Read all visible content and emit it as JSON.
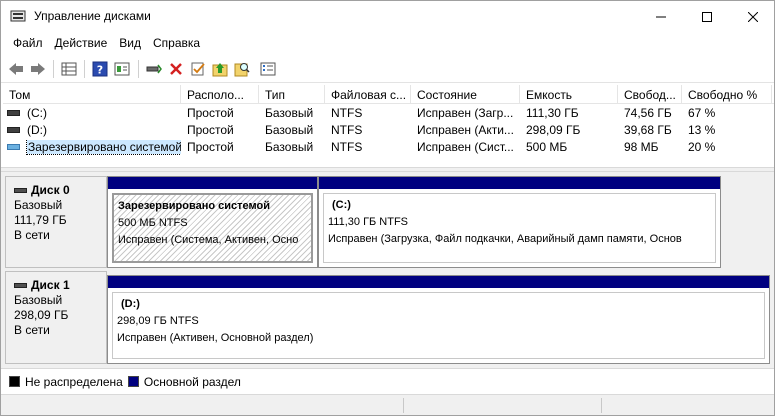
{
  "window": {
    "title": "Управление дисками"
  },
  "menu": [
    "Файл",
    "Действие",
    "Вид",
    "Справка"
  ],
  "table": {
    "columns": [
      "Том",
      "Располо...",
      "Тип",
      "Файловая с...",
      "Состояние",
      "Емкость",
      "Свобод...",
      "Свободно %"
    ],
    "rows": [
      {
        "name": "(C:)",
        "layout": "Простой",
        "type": "Базовый",
        "fs": "NTFS",
        "status": "Исправен (Загр...",
        "capacity": "111,30 ГБ",
        "free": "74,56 ГБ",
        "free_pct": "67 %"
      },
      {
        "name": "(D:)",
        "layout": "Простой",
        "type": "Базовый",
        "fs": "NTFS",
        "status": "Исправен (Акти...",
        "capacity": "298,09 ГБ",
        "free": "39,68 ГБ",
        "free_pct": "13 %"
      },
      {
        "name": "Зарезервировано системой",
        "layout": "Простой",
        "type": "Базовый",
        "fs": "NTFS",
        "status": "Исправен (Сист...",
        "capacity": "500 МБ",
        "free": "98 МБ",
        "free_pct": "20 %"
      }
    ]
  },
  "disks": [
    {
      "name": "Диск 0",
      "type": "Базовый",
      "size": "111,79 ГБ",
      "state": "В сети",
      "partitions": [
        {
          "name": "Зарезервировано системой",
          "size": "500 МБ NTFS",
          "status": "Исправен (Система, Активен, Осно"
        },
        {
          "name": "(C:)",
          "size": "111,30 ГБ NTFS",
          "status": "Исправен (Загрузка, Файл подкачки, Аварийный дамп памяти, Основ"
        }
      ]
    },
    {
      "name": "Диск 1",
      "type": "Базовый",
      "size": "298,09 ГБ",
      "state": "В сети",
      "partitions": [
        {
          "name": "(D:)",
          "size": "298,09 ГБ NTFS",
          "status": "Исправен (Активен, Основной раздел)"
        }
      ]
    }
  ],
  "legend": {
    "unallocated": "Не распределена",
    "primary": "Основной раздел"
  },
  "colors": {
    "primary": "#000080",
    "unallocated": "#000000",
    "selection": "#cce8ff"
  },
  "icons": [
    "app-icon",
    "back-icon",
    "forward-icon",
    "disk-list-icon",
    "help-icon",
    "properties-icon",
    "connect-icon",
    "delete-icon",
    "check-icon",
    "up-icon",
    "search-icon",
    "settings-list-icon"
  ]
}
